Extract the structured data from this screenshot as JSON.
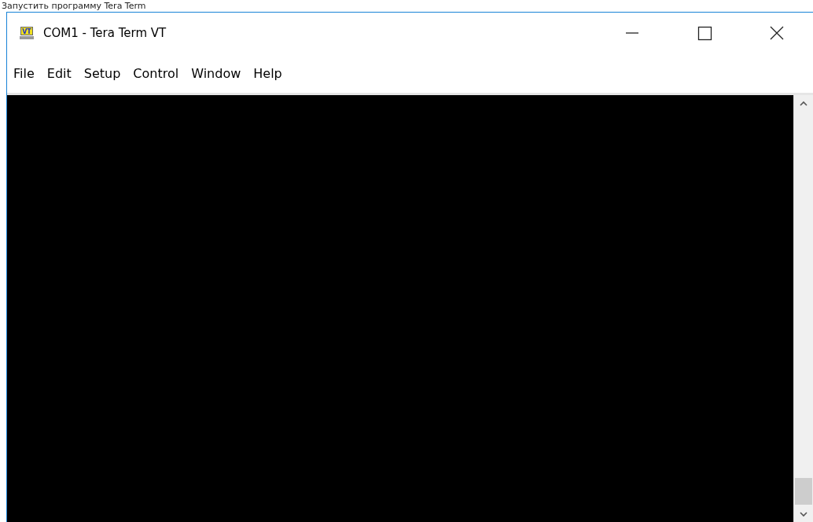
{
  "caption": "Запустить программу Tera Term",
  "window": {
    "title": "COM1 - Tera Term VT",
    "app_icon_text": "VT"
  },
  "menu": [
    {
      "label": "File"
    },
    {
      "label": "Edit"
    },
    {
      "label": "Setup"
    },
    {
      "label": "Control"
    },
    {
      "label": "Window"
    },
    {
      "label": "Help"
    }
  ]
}
